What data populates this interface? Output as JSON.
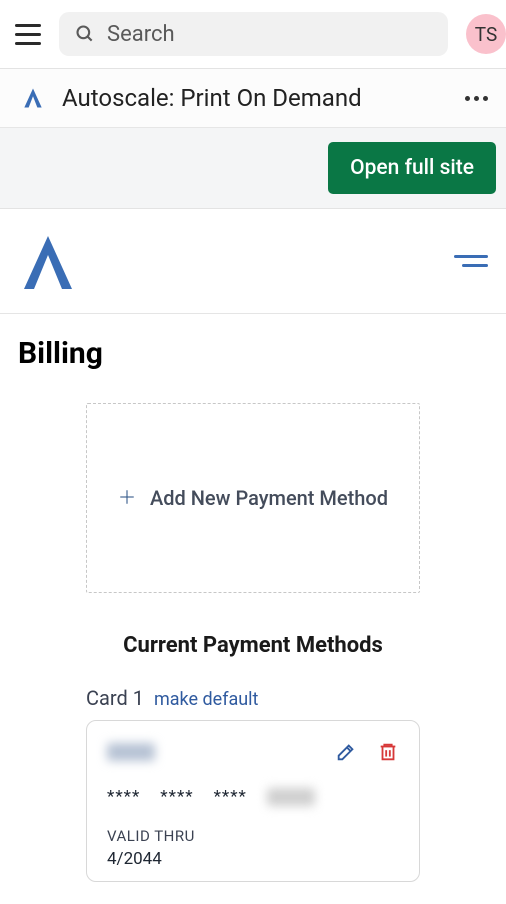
{
  "topbar": {
    "search_placeholder": "Search",
    "avatar_initials": "TS"
  },
  "app_header": {
    "title": "Autoscale: Print On Demand",
    "open_full_site_label": "Open full site"
  },
  "page": {
    "title": "Billing"
  },
  "add_payment": {
    "label": "Add New Payment Method"
  },
  "payment_methods": {
    "section_title": "Current Payment Methods",
    "cards": [
      {
        "name": "Card 1",
        "make_default": "make default",
        "masked_group": "****",
        "valid_thru_label": "VALID THRU",
        "valid_thru_value": "4/2044"
      }
    ]
  },
  "colors": {
    "primary_green": "#0a7745",
    "link_blue": "#2f5a9f",
    "brand_blue": "#3a6db5",
    "danger_red": "#d73838"
  }
}
